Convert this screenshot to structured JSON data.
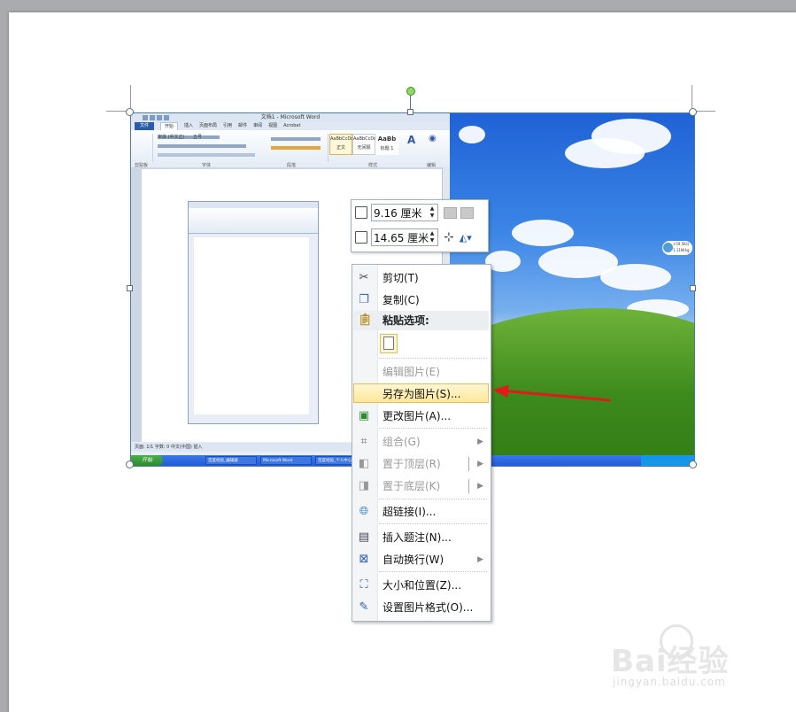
{
  "embedded_picture": {
    "word_window": {
      "title": "文档1 - Microsoft Word",
      "tabs": [
        "文件",
        "开始",
        "插入",
        "页面布局",
        "引用",
        "邮件",
        "审阅",
        "视图",
        "Acrobat"
      ],
      "styles": [
        "AaBbCcDd",
        "AaBbCcDd",
        "AaBb"
      ],
      "style_names": [
        "正文",
        "无间隔",
        "标题 1"
      ],
      "groups": [
        "剪贴板",
        "字体",
        "段落",
        "样式",
        "编辑"
      ],
      "font": "宋体 (中文正)",
      "font_size": "五号",
      "status": "页面: 1/1   字数: 0   中文(中国)   插入"
    },
    "taskbar": {
      "start": "开始",
      "items": [
        "百度经验_编辑器",
        "Microsoft Word",
        "百度经验_个人中心"
      ]
    },
    "desktop_badge": {
      "line1": "+59.5K/s",
      "line2": "1.11M/kg"
    }
  },
  "size_toolbar": {
    "height_value": "9.16 厘米",
    "width_value": "14.65 厘米"
  },
  "context_menu": {
    "items": [
      {
        "label": "剪切(T)",
        "icon": "scissors-icon",
        "enabled": true
      },
      {
        "label": "复制(C)",
        "icon": "copy-icon",
        "enabled": true
      },
      {
        "label": "编辑图片(E)",
        "enabled": false
      },
      {
        "label": "另存为图片(S)...",
        "enabled": true,
        "highlighted": true
      },
      {
        "label": "更改图片(A)...",
        "icon": "change-picture-icon",
        "enabled": true
      },
      {
        "label": "组合(G)",
        "icon": "group-icon",
        "enabled": false,
        "submenu": true
      },
      {
        "label": "置于顶层(R)",
        "icon": "bring-front-icon",
        "enabled": false,
        "submenu": true
      },
      {
        "label": "置于底层(K)",
        "icon": "send-back-icon",
        "enabled": false,
        "submenu": true
      },
      {
        "label": "超链接(I)...",
        "icon": "hyperlink-icon",
        "enabled": true
      },
      {
        "label": "插入题注(N)...",
        "icon": "caption-icon",
        "enabled": true
      },
      {
        "label": "自动换行(W)",
        "icon": "wrap-text-icon",
        "enabled": true,
        "submenu": true
      },
      {
        "label": "大小和位置(Z)...",
        "icon": "size-position-icon",
        "enabled": true
      },
      {
        "label": "设置图片格式(O)...",
        "icon": "format-picture-icon",
        "enabled": true
      }
    ],
    "paste_header": "粘贴选项:"
  },
  "watermark": {
    "brand": "Bai经验",
    "url": "jingyan.baidu.com"
  },
  "colors": {
    "highlight": "#ffe79a",
    "arrow": "#e21a1a",
    "selection_border": "#4a7bb5"
  }
}
